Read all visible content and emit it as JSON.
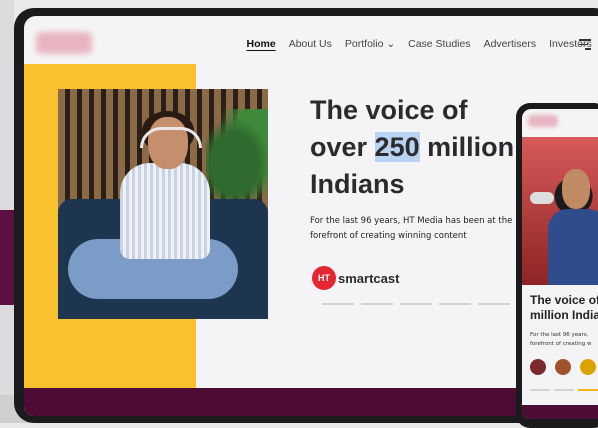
{
  "nav": {
    "items": [
      {
        "label": "Home",
        "active": true
      },
      {
        "label": "About Us"
      },
      {
        "label": "Portfolio ⌄"
      },
      {
        "label": "Case Studies"
      },
      {
        "label": "Advertisers"
      },
      {
        "label": "Investors"
      }
    ]
  },
  "hero": {
    "headline_line1": "The voice of",
    "headline_pre": "over ",
    "headline_highlight": "250",
    "headline_post": " million",
    "headline_line3": "Indians",
    "subtext_line1": "For the last 96 years, HT Media has been at the",
    "subtext_line2": "forefront of creating winning content",
    "brand_badge": "HT",
    "brand_word": "smartcast"
  },
  "carousel": {
    "count": 6,
    "active_index": 5
  },
  "phone": {
    "title_line1": "The voice of",
    "title_line2": "million Indian",
    "sub_line1": "For the last 96 years,",
    "sub_line2": "forefront of creating w"
  },
  "colors": {
    "accent_yellow": "#f9c12e",
    "brand_purple": "#4c0c33",
    "highlight_blue": "#b9d4f2"
  }
}
